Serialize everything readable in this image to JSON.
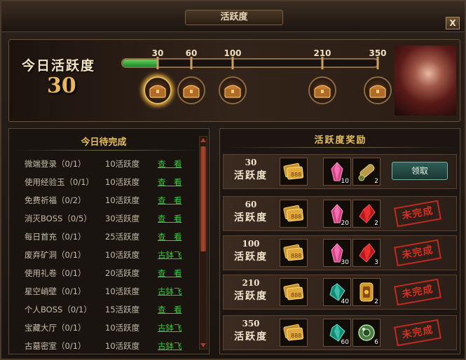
{
  "window": {
    "title": "活跃度",
    "close_label": "X"
  },
  "summary": {
    "label": "今日活跃度",
    "value": "30",
    "progress_fraction": 0.14
  },
  "milestones": [
    {
      "label": "30",
      "highlight": true
    },
    {
      "label": "60",
      "highlight": false
    },
    {
      "label": "100",
      "highlight": false
    },
    {
      "label": "210",
      "highlight": false
    },
    {
      "label": "350",
      "highlight": false
    }
  ],
  "tasks": {
    "header": "今日待完成",
    "items": [
      {
        "name": "微端登录（0/1）",
        "points": "10活跃度",
        "action": "查　看"
      },
      {
        "name": "使用经验玉（0/1）",
        "points": "10活跃度",
        "action": "查　看"
      },
      {
        "name": "免费祈福（0/2）",
        "points": "10活跃度",
        "action": "查　看"
      },
      {
        "name": "消灭BOSS（0/5）",
        "points": "30活跃度",
        "action": "查　看"
      },
      {
        "name": "每日首充（0/1）",
        "points": "25活跃度",
        "action": "查　看"
      },
      {
        "name": "废弃矿洞（0/1）",
        "points": "10活跃度",
        "action": "古鉢飞"
      },
      {
        "name": "使用礼卷（0/1）",
        "points": "20活跃度",
        "action": "查　看"
      },
      {
        "name": "星空峭壁（0/1）",
        "points": "10活跃度",
        "action": "古鉢飞"
      },
      {
        "name": "个人BOSS（0/1）",
        "points": "15活跃度",
        "action": "查　看"
      },
      {
        "name": "宝藏大厅（0/1）",
        "points": "10活跃度",
        "action": "古鉢飞"
      },
      {
        "name": "古墓密室（0/1）",
        "points": "10活跃度",
        "action": "古鉢飞"
      }
    ]
  },
  "rewards": {
    "header": "活跃度奖励",
    "tier_label": "活跃度",
    "claim_label": "领取",
    "incomplete_label": "未完成",
    "rows": [
      {
        "tier": "30",
        "status": "claim",
        "items": [
          {
            "icon": "gold-ticket-icon",
            "count": ""
          },
          {
            "icon": "pink-crystal-icon",
            "count": "10"
          },
          {
            "icon": "scroll-icon",
            "count": "2"
          }
        ]
      },
      {
        "tier": "60",
        "status": "incomplete",
        "items": [
          {
            "icon": "gold-ticket-icon",
            "count": ""
          },
          {
            "icon": "pink-crystal-icon",
            "count": "20"
          },
          {
            "icon": "red-shard-icon",
            "count": "2"
          }
        ]
      },
      {
        "tier": "100",
        "status": "incomplete",
        "items": [
          {
            "icon": "gold-ticket-icon",
            "count": ""
          },
          {
            "icon": "pink-crystal-icon",
            "count": "30"
          },
          {
            "icon": "red-shard-icon",
            "count": "3"
          }
        ]
      },
      {
        "tier": "210",
        "status": "incomplete",
        "items": [
          {
            "icon": "gold-ticket-icon",
            "count": ""
          },
          {
            "icon": "green-gem-icon",
            "count": "40"
          },
          {
            "icon": "gold-token-icon",
            "count": "2"
          }
        ]
      },
      {
        "tier": "350",
        "status": "incomplete",
        "items": [
          {
            "icon": "gold-ticket-icon",
            "count": ""
          },
          {
            "icon": "green-gem-icon",
            "count": "60"
          },
          {
            "icon": "jade-orb-icon",
            "count": "6"
          }
        ]
      }
    ]
  }
}
